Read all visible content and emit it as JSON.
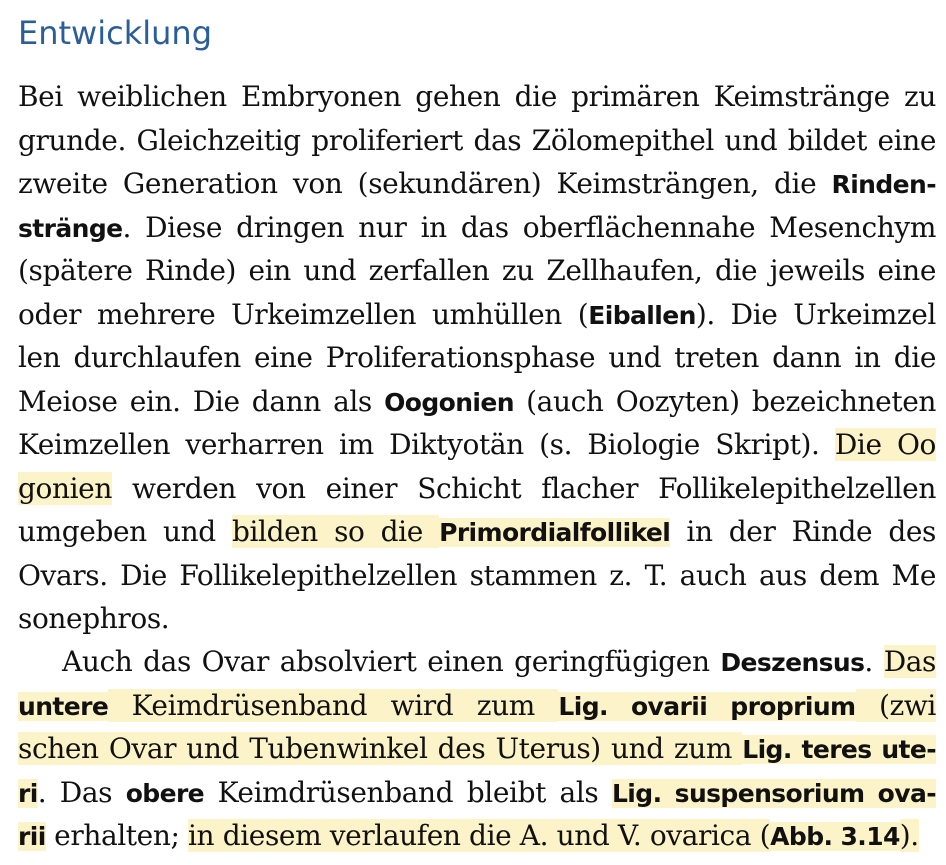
{
  "colors": {
    "heading": "#2b5e99",
    "text": "#111111",
    "highlight": "#fdf3c8",
    "background": "#ffffff"
  },
  "heading": "Entwicklung",
  "paragraphs": [
    {
      "indent": false,
      "lines": [
        [
          {
            "t": "Bei weiblichen Embryonen gehen die primären Keimstränge zu",
            "b": false,
            "h": false
          }
        ],
        [
          {
            "t": "grunde. Gleichzeitig proliferiert das Zölomepithel und bildet eine",
            "b": false,
            "h": false
          }
        ],
        [
          {
            "t": "zweite Generation von (sekundären) Keimsträngen, die ",
            "b": false,
            "h": false
          },
          {
            "t": "Rinden-",
            "b": true,
            "h": false
          }
        ],
        [
          {
            "t": "stränge",
            "b": true,
            "h": false
          },
          {
            "t": ". Diese dringen nur in das oberflächennahe Mesenchym",
            "b": false,
            "h": false
          }
        ],
        [
          {
            "t": "(spätere Rinde) ein und zerfallen zu Zellhaufen, die jeweils eine",
            "b": false,
            "h": false
          }
        ],
        [
          {
            "t": "oder mehrere Urkeimzellen umhüllen (",
            "b": false,
            "h": false
          },
          {
            "t": "Eiballen",
            "b": true,
            "h": false
          },
          {
            "t": "). Die Urkeimzel",
            "b": false,
            "h": false
          }
        ],
        [
          {
            "t": "len durchlaufen eine Proliferationsphase und treten dann in die",
            "b": false,
            "h": false
          }
        ],
        [
          {
            "t": "Meiose ein. Die dann als ",
            "b": false,
            "h": false
          },
          {
            "t": "Oogonien",
            "b": true,
            "h": false
          },
          {
            "t": " (auch Oozyten) bezeichneten",
            "b": false,
            "h": false
          }
        ],
        [
          {
            "t": "Keimzellen verharren im Diktyotän (s. Biologie Skript). ",
            "b": false,
            "h": false
          },
          {
            "t": "Die Oo",
            "b": false,
            "h": true
          }
        ],
        [
          {
            "t": "gonien",
            "b": false,
            "h": true
          },
          {
            "t": " werden von einer Schicht flacher Follikelepithelzellen",
            "b": false,
            "h": false
          }
        ],
        [
          {
            "t": "umgeben und ",
            "b": false,
            "h": false
          },
          {
            "t": "bilden so die ",
            "b": false,
            "h": true
          },
          {
            "t": "Primordialfollikel",
            "b": true,
            "h": true
          },
          {
            "t": " in der Rinde des",
            "b": false,
            "h": false
          }
        ],
        [
          {
            "t": "Ovars. Die Follikelepithelzellen stammen z. T. auch aus dem Me",
            "b": false,
            "h": false
          }
        ],
        [
          {
            "t": "sonephros.",
            "b": false,
            "h": false
          }
        ]
      ]
    },
    {
      "indent": true,
      "lines": [
        [
          {
            "t": "Auch das Ovar absolviert einen geringfügigen ",
            "b": false,
            "h": false
          },
          {
            "t": "Deszensus",
            "b": true,
            "h": false
          },
          {
            "t": ". ",
            "b": false,
            "h": false
          },
          {
            "t": "Das",
            "b": false,
            "h": true
          }
        ],
        [
          {
            "t": "untere",
            "b": true,
            "h": true
          },
          {
            "t": " Keimdrüsenband wird zum ",
            "b": false,
            "h": true
          },
          {
            "t": "Lig. ovarii proprium",
            "b": true,
            "h": true
          },
          {
            "t": " (zwi",
            "b": false,
            "h": true
          }
        ],
        [
          {
            "t": "schen Ovar und Tubenwinkel des Uterus) und zum ",
            "b": false,
            "h": true
          },
          {
            "t": "Lig. teres ute-",
            "b": true,
            "h": true
          }
        ],
        [
          {
            "t": "ri",
            "b": true,
            "h": true
          },
          {
            "t": ". Das ",
            "b": false,
            "h": false
          },
          {
            "t": "obere",
            "b": true,
            "h": false
          },
          {
            "t": " Keimdrüsenband bleibt als ",
            "b": false,
            "h": false
          },
          {
            "t": "Lig. suspensorium ova-",
            "b": true,
            "h": true
          }
        ],
        [
          {
            "t": "rii",
            "b": true,
            "h": true
          },
          {
            "t": " erhalten; ",
            "b": false,
            "h": false
          },
          {
            "t": "in diesem verlaufen die A. und V. ovarica (",
            "b": false,
            "h": true
          },
          {
            "t": "Abb. 3.14",
            "b": true,
            "h": true
          },
          {
            "t": ").",
            "b": false,
            "h": true
          }
        ]
      ]
    }
  ]
}
